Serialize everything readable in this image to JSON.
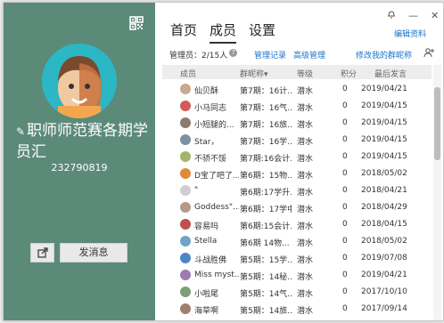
{
  "window": {
    "tabs": [
      {
        "label": "首页"
      },
      {
        "label": "成员"
      },
      {
        "label": "设置"
      }
    ],
    "edit_profile": "编辑资料"
  },
  "group": {
    "name": "职师师范赛各期学员汇",
    "id": "232790819",
    "send_button": "发消息"
  },
  "info": {
    "admin_count": "管理员：2/15人",
    "manage_records": "管理记录",
    "advanced": "高级管理",
    "edit_nick": "修改我的群昵称"
  },
  "table": {
    "headers": {
      "member": "成员",
      "card": "群昵称",
      "level": "等级",
      "points": "积分",
      "last": "最后发言"
    },
    "rows": [
      {
        "name": "仙贝酥",
        "card": "第7期：16计...",
        "level": "潜水",
        "points": "0",
        "date": "2019/04/21",
        "color": "#c9a88f"
      },
      {
        "name": "小马同志",
        "card": "第7期：16气...",
        "level": "潜水",
        "points": "0",
        "date": "2019/04/15",
        "color": "#d55a5a"
      },
      {
        "name": "小短腿的...",
        "card": "第7期：16旅...",
        "level": "潜水",
        "points": "0",
        "date": "2019/04/15",
        "color": "#8a7b6e"
      },
      {
        "name": "Star，",
        "card": "第7期：16学...",
        "level": "潜水",
        "points": "0",
        "date": "2019/04/15",
        "color": "#7e8fa0"
      },
      {
        "name": "不骄不馁",
        "card": "第7期:16会计...",
        "level": "潜水",
        "points": "0",
        "date": "2019/04/15",
        "color": "#a2b66b"
      },
      {
        "name": "D宝了吧了...",
        "card": "第6期：15物...",
        "level": "潜水",
        "points": "0",
        "date": "2018/05/02",
        "color": "#e08a3c"
      },
      {
        "name": "\"",
        "card": "第6期:17学升...",
        "level": "潜水",
        "points": "0",
        "date": "2018/04/21",
        "color": "#cfcfcf"
      },
      {
        "name": "Goddess\"...",
        "card": "第6期：17学中...",
        "level": "潜水",
        "points": "0",
        "date": "2018/04/29",
        "color": "#b49a8a"
      },
      {
        "name": "容易吗",
        "card": "第6期:15会计...",
        "level": "潜水",
        "points": "0",
        "date": "2018/04/15",
        "color": "#c05050"
      },
      {
        "name": "Stella",
        "card": "第6期 14物...",
        "level": "潜水",
        "points": "0",
        "date": "2018/05/02",
        "color": "#6fa3c8"
      },
      {
        "name": "斗战胜佛",
        "card": "第5期：15学...",
        "level": "潜水",
        "points": "0",
        "date": "2019/07/08",
        "color": "#4e86c4"
      },
      {
        "name": "Miss myst...",
        "card": "第5期：14秘...",
        "level": "潜水",
        "points": "0",
        "date": "2019/04/21",
        "color": "#9b7cb0"
      },
      {
        "name": "小啦尾",
        "card": "第5期：14气...",
        "level": "潜水",
        "points": "0",
        "date": "2017/10/10",
        "color": "#7aa07a"
      },
      {
        "name": "海草啊",
        "card": "第5期：14旅...",
        "level": "潜水",
        "points": "0",
        "date": "2017/09/14",
        "color": "#a08070"
      }
    ]
  }
}
